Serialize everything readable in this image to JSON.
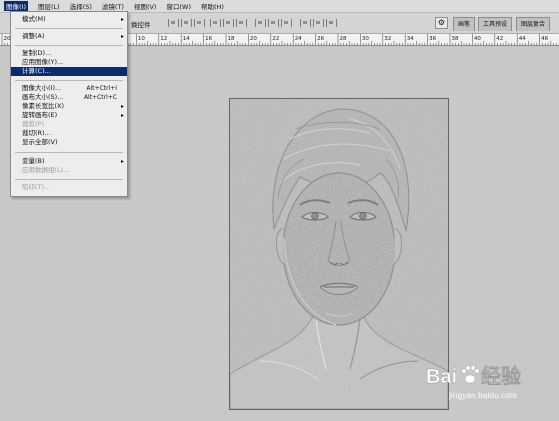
{
  "menubar": {
    "items": [
      "图像(I)",
      "图层(L)",
      "选择(S)",
      "滤镜(T)",
      "视图(V)",
      "窗口(W)",
      "帮助(H)"
    ],
    "active_index": 0
  },
  "toolbar": {
    "label": "换控件",
    "gear": "⚙",
    "panel_tabs": [
      "画笔",
      "工具预设",
      "图层复合"
    ]
  },
  "ruler": {
    "labels": [
      "20",
      "0",
      "2",
      "4",
      "6",
      "8",
      "10",
      "12",
      "14",
      "16",
      "18",
      "20",
      "22",
      "24",
      "26",
      "28",
      "30",
      "32",
      "34",
      "36",
      "38",
      "40",
      "42",
      "44",
      "46",
      "48"
    ]
  },
  "dropdown": {
    "items": [
      {
        "label": "模式(M)",
        "submenu": true
      },
      {
        "label": "调整(A)",
        "submenu": true
      },
      {
        "label": "复制(D)..."
      },
      {
        "label": "应用图像(Y)..."
      },
      {
        "label": "计算(C)...",
        "selected": true
      },
      {
        "label": "图像大小(I)...",
        "shortcut": "Alt+Ctrl+I"
      },
      {
        "label": "画布大小(S)...",
        "shortcut": "Alt+Ctrl+C"
      },
      {
        "label": "像素长宽比(X)",
        "submenu": true
      },
      {
        "label": "旋转画布(E)",
        "submenu": true
      },
      {
        "label": "裁剪(P)",
        "disabled": true
      },
      {
        "label": "裁切(R)..."
      },
      {
        "label": "显示全部(V)"
      },
      {
        "label": "变量(B)",
        "submenu": true
      },
      {
        "label": "应用数据组(L)...",
        "disabled": true
      },
      {
        "label": "陷印(T)...",
        "disabled": true
      }
    ],
    "arrow_glyph": "▸"
  },
  "watermark": {
    "text": "jingyan.baidu.com"
  },
  "colors": {
    "menu_highlight": "#0b2a6f",
    "workspace": "#c8c8c8",
    "menu_bg": "#ededed"
  }
}
